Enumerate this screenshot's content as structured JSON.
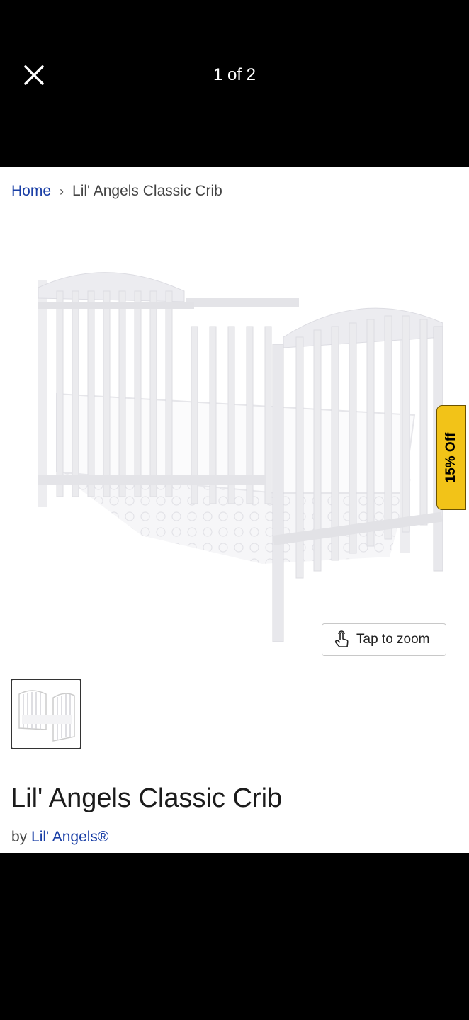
{
  "viewer": {
    "counter": "1 of 2"
  },
  "breadcrumb": {
    "home": "Home",
    "separator": "›",
    "current": "Lil' Angels Classic Crib"
  },
  "product": {
    "badge": "15% Off",
    "zoom_label": "Tap to zoom",
    "title": "Lil' Angels Classic Crib",
    "brand_prefix": "by",
    "brand": "Lil' Angels®"
  },
  "colors": {
    "link": "#1a3fa6",
    "badge": "#f2c318",
    "crib": "#e9e9ed"
  },
  "icons": {
    "close": "close-icon",
    "zoom": "tap-hand-icon",
    "chevron": "chevron-right-icon"
  }
}
